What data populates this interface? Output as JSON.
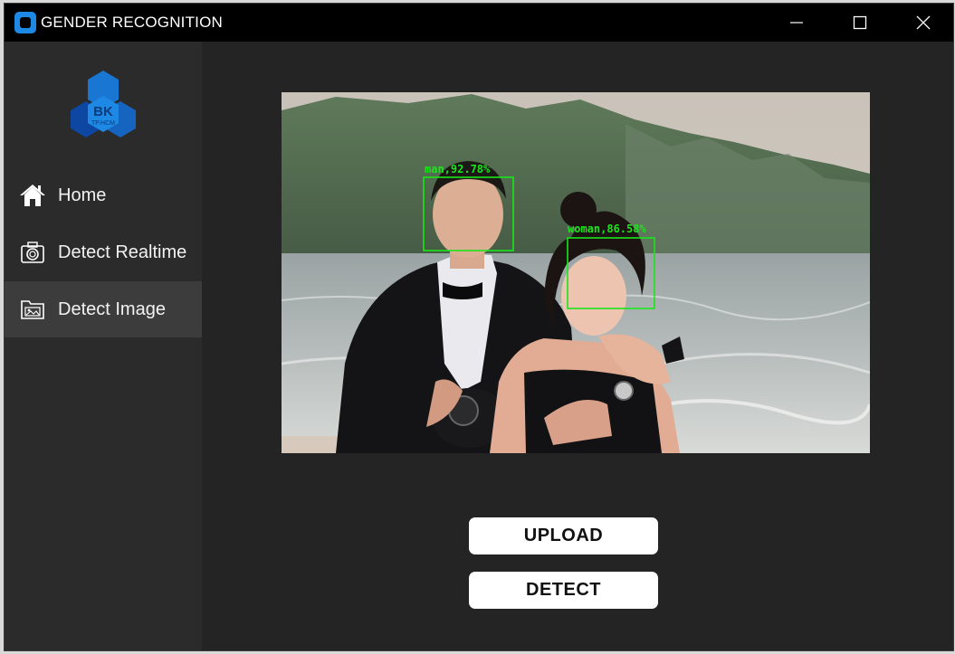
{
  "window": {
    "title": "GENDER RECOGNITION",
    "controls": [
      "minimize-icon",
      "maximize-icon",
      "close-icon"
    ]
  },
  "sidebar": {
    "logo": {
      "text": "BK",
      "subtext": "TP.HCM"
    },
    "items": [
      {
        "label": "Home",
        "icon": "home-icon",
        "active": false
      },
      {
        "label": "Detect Realtime",
        "icon": "camera-icon",
        "active": false
      },
      {
        "label": "Detect Image",
        "icon": "folder-image-icon",
        "active": true
      }
    ]
  },
  "main": {
    "detections": [
      {
        "label": "man,92.78%"
      },
      {
        "label": "woman,86.58%"
      }
    ],
    "buttons": {
      "upload": "UPLOAD",
      "detect": "DETECT"
    }
  },
  "colors": {
    "titlebar": "#000000",
    "sidebar": "#2b2b2b",
    "sidebar_active": "#3c3c3c",
    "main_bg": "#242424",
    "detection_box": "#19e619",
    "logo_blue": "#1565c0",
    "app_icon": "#1e88e5"
  }
}
